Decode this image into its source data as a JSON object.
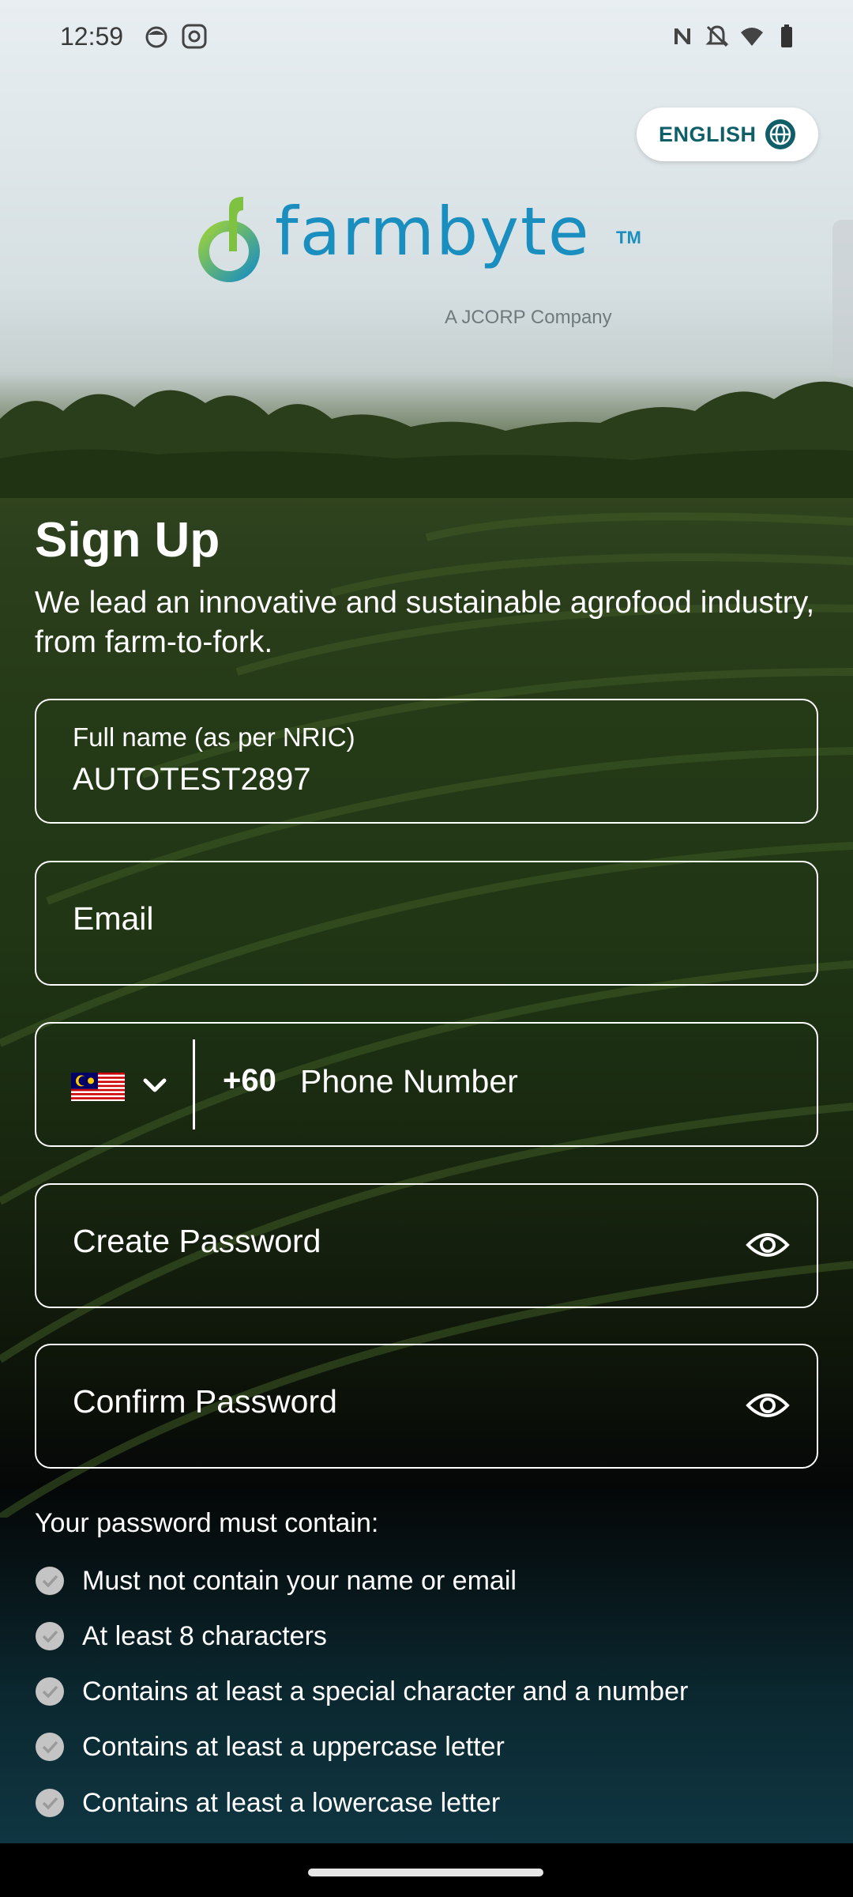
{
  "status_bar": {
    "time": "12:59",
    "left_icons": [
      "face-icon",
      "camera-settings-icon"
    ],
    "right_icons": [
      "nfc-icon",
      "bell-off-icon",
      "wifi-icon",
      "battery-icon"
    ]
  },
  "language": {
    "label": "ENGLISH",
    "icon": "globe-icon"
  },
  "logo": {
    "wordmark": "farmbyte",
    "trademark": "TM",
    "tagline": "A JCORP Company"
  },
  "signup": {
    "title": "Sign Up",
    "subtitle": "We lead an innovative and sustainable agrofood industry, from farm-to-fork."
  },
  "form": {
    "full_name": {
      "label": "Full name (as per NRIC)",
      "value": "AUTOTEST2897"
    },
    "email": {
      "placeholder": "Email"
    },
    "phone": {
      "country": "Malaysia",
      "prefix": "+60",
      "placeholder": "Phone Number"
    },
    "create_password": {
      "placeholder": "Create Password"
    },
    "confirm_password": {
      "placeholder": "Confirm Password"
    }
  },
  "password_rules": {
    "heading": "Your password must contain:",
    "items": [
      "Must not contain your name or email",
      "At least 8 characters",
      "Contains at least a special character and a number",
      "Contains at least a uppercase letter",
      "Contains at least a lowercase letter"
    ]
  },
  "colors": {
    "brand_teal": "#0f5e68",
    "brand_blue": "#1a8fbf",
    "brand_green": "#7fc241"
  }
}
